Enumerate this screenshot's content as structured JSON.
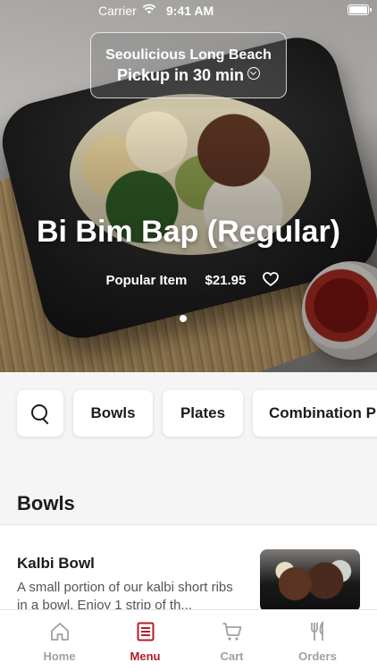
{
  "status_bar": {
    "carrier": "Carrier",
    "time": "9:41 AM"
  },
  "location": {
    "name": "Seoulicious Long Beach",
    "pickup": "Pickup in 30 min"
  },
  "featured": {
    "title": "Bi Bim Bap (Regular)",
    "tag": "Popular Item",
    "price": "$21.95",
    "favorite_icon": "heart-outline-icon",
    "page_index": 1,
    "page_count": 1
  },
  "categories": {
    "search_icon": "search-icon",
    "items": [
      "Bowls",
      "Plates",
      "Combination Plates"
    ],
    "visible": [
      "Bowls",
      "Plates",
      "Combination P"
    ]
  },
  "section": {
    "title": "Bowls"
  },
  "menu_items": [
    {
      "name": "Kalbi Bowl",
      "description": "A small portion of our kalbi short ribs in a bowl. Enjoy 1 strip of th..."
    }
  ],
  "tab_bar": {
    "active_color": "#b01e28",
    "inactive_color": "#a0a0a4",
    "tabs": [
      {
        "label": "Home",
        "icon": "home-icon"
      },
      {
        "label": "Menu",
        "icon": "menu-book-icon",
        "active": true
      },
      {
        "label": "Cart",
        "icon": "cart-icon"
      },
      {
        "label": "Orders",
        "icon": "fork-knife-icon"
      }
    ]
  }
}
